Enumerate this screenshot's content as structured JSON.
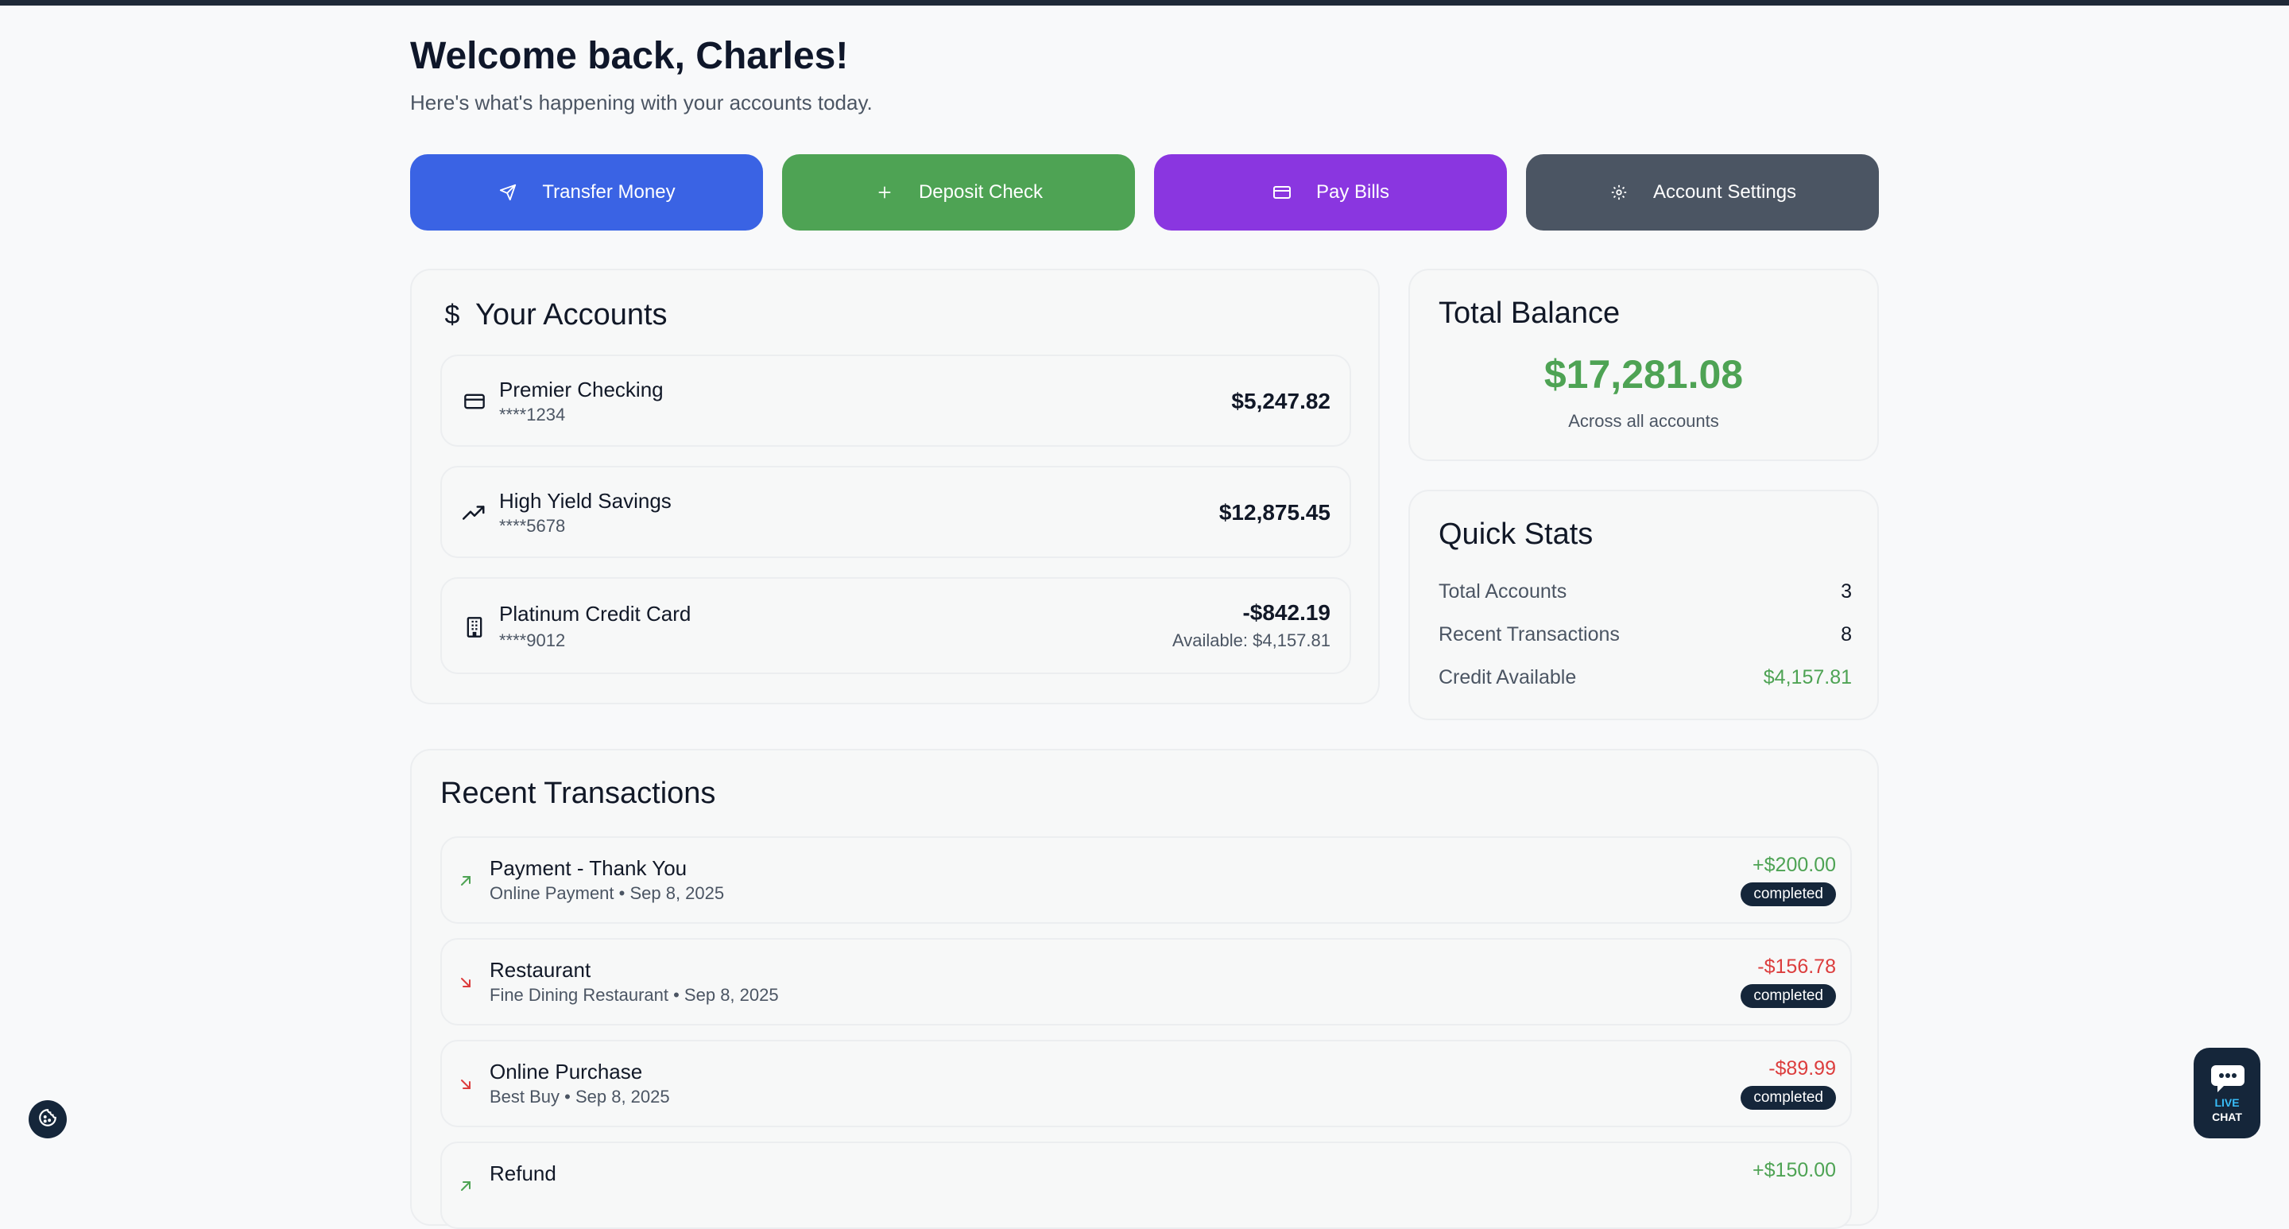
{
  "header": {
    "title": "Welcome back, Charles!",
    "subtitle": "Here's what's happening with your accounts today."
  },
  "actions": [
    {
      "label": "Transfer Money",
      "icon": "send-icon",
      "color": "#3a63e4"
    },
    {
      "label": "Deposit Check",
      "icon": "plus-icon",
      "color": "#4ea354"
    },
    {
      "label": "Pay Bills",
      "icon": "credit-card-icon",
      "color": "#8a36e0"
    },
    {
      "label": "Account Settings",
      "icon": "gear-icon",
      "color": "#4b5563"
    }
  ],
  "accounts": {
    "title": "Your Accounts",
    "title_icon": "$",
    "items": [
      {
        "name": "Premier Checking",
        "number": "****1234",
        "balance": "$5,247.82",
        "icon": "credit-card-icon"
      },
      {
        "name": "High Yield Savings",
        "number": "****5678",
        "balance": "$12,875.45",
        "icon": "trending-up-icon"
      },
      {
        "name": "Platinum Credit Card",
        "number": "****9012",
        "balance": "-$842.19",
        "available": "Available: $4,157.81",
        "icon": "building-icon"
      }
    ]
  },
  "total_balance": {
    "title": "Total Balance",
    "amount": "$17,281.08",
    "subtitle": "Across all accounts"
  },
  "quick_stats": {
    "title": "Quick Stats",
    "rows": [
      {
        "label": "Total Accounts",
        "value": "3"
      },
      {
        "label": "Recent Transactions",
        "value": "8"
      },
      {
        "label": "Credit Available",
        "value": "$4,157.81"
      }
    ]
  },
  "transactions": {
    "title": "Recent Transactions",
    "items": [
      {
        "name": "Payment - Thank You",
        "meta": "Online Payment • Sep 8, 2025",
        "amount": "+$200.00",
        "status": "completed",
        "direction": "in"
      },
      {
        "name": "Restaurant",
        "meta": "Fine Dining Restaurant • Sep 8, 2025",
        "amount": "-$156.78",
        "status": "completed",
        "direction": "out"
      },
      {
        "name": "Online Purchase",
        "meta": "Best Buy • Sep 8, 2025",
        "amount": "-$89.99",
        "status": "completed",
        "direction": "out"
      },
      {
        "name": "Refund",
        "meta": "",
        "amount": "+$150.00",
        "status": "",
        "direction": "in"
      }
    ]
  },
  "chat": {
    "live": "LIVE",
    "chat": "CHAT"
  },
  "colors": {
    "positive": "#4ea354",
    "negative": "#dc3d3d",
    "badge": "#15263a"
  }
}
